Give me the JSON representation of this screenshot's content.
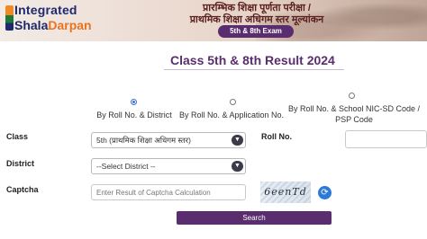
{
  "header": {
    "brand_line1": "Integrated",
    "brand_line2_prefix": "Shala",
    "brand_line2_suffix": "Darpan",
    "hindi_line1": "प्रारम्भिक शिक्षा पूर्णता परीक्षा /",
    "hindi_line2": "प्राथमिक शिक्षा अधिगम स्तर मूल्यांकन",
    "exam_badge": "5th & 8th Exam"
  },
  "page_title": "Class 5th & 8th Result 2024",
  "search_options": [
    {
      "label": "By Roll No. & District",
      "selected": true
    },
    {
      "label": "By Roll No. & Application No.",
      "selected": false
    },
    {
      "label": "By Roll No. & School NIC-SD Code / PSP Code",
      "selected": false
    }
  ],
  "form": {
    "class_label": "Class",
    "class_value": "5th (प्राथमिक शिक्षा अधिगम स्तर)",
    "roll_label": "Roll No.",
    "roll_value": "",
    "district_label": "District",
    "district_value": "--Select District --",
    "captcha_label": "Captcha",
    "captcha_placeholder": "Enter Result of Captcha Calculation",
    "captcha_text": "6eenTd",
    "search_label": "Search"
  },
  "colors": {
    "brand_navy": "#1d2a6b",
    "brand_orange": "#e8741f",
    "accent_purple": "#5a2d6e",
    "refresh_blue": "#2d79d8"
  },
  "icons": {
    "select_arrow": "chevron-down-icon",
    "refresh": "refresh-icon",
    "radio_selected": "radio-selected",
    "radio": "radio"
  }
}
